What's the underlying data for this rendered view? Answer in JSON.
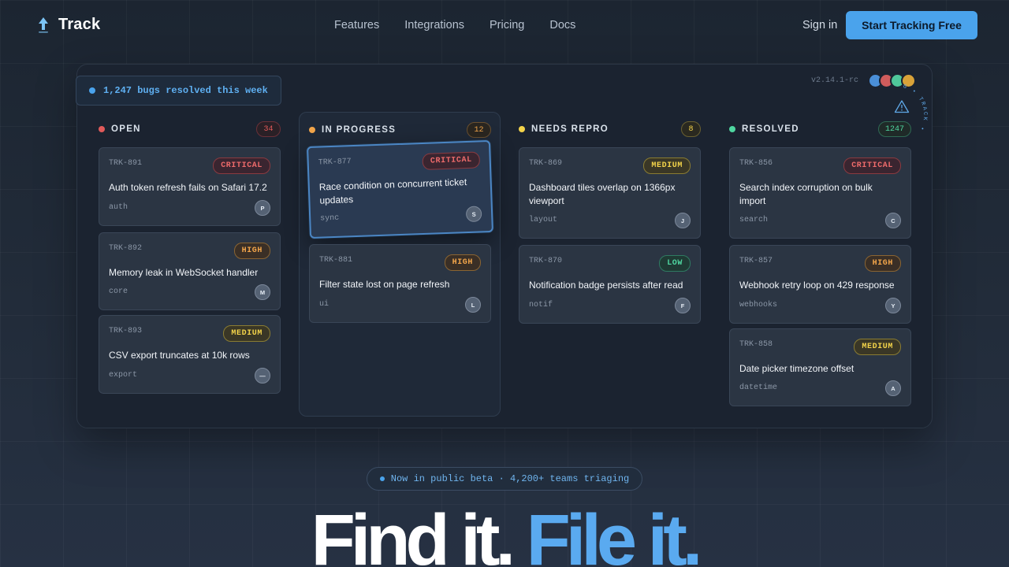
{
  "brand": {
    "name": "Track"
  },
  "nav": {
    "links": [
      "Features",
      "Integrations",
      "Pricing",
      "Docs"
    ],
    "signin": "Sign in",
    "cta": "Start Tracking Free"
  },
  "board": {
    "resolved_banner": "1,247 bugs resolved this week",
    "version": "v2.14.1-rc",
    "ring_text": "BUG • TRACK •",
    "columns": [
      {
        "title": "OPEN",
        "count": "34",
        "color": "#e05a5a",
        "cards": [
          {
            "id": "TRK-891",
            "severity": "CRITICAL",
            "title": "Auth token refresh fails on Safari 17.2",
            "tag": "auth",
            "assignee": "P"
          },
          {
            "id": "TRK-892",
            "severity": "HIGH",
            "title": "Memory leak in WebSocket handler",
            "tag": "core",
            "assignee": "M"
          },
          {
            "id": "TRK-893",
            "severity": "MEDIUM",
            "title": "CSV export truncates at 10k rows",
            "tag": "export",
            "assignee": "—"
          }
        ]
      },
      {
        "title": "IN PROGRESS",
        "count": "12",
        "color": "#f2a54a",
        "cards": [
          {
            "id": "TRK-877",
            "severity": "CRITICAL",
            "title": "Race condition on concurrent ticket updates",
            "tag": "sync",
            "assignee": "S"
          },
          {
            "id": "TRK-881",
            "severity": "HIGH",
            "title": "Filter state lost on page refresh",
            "tag": "ui",
            "assignee": "L"
          }
        ]
      },
      {
        "title": "NEEDS REPRO",
        "count": "8",
        "color": "#f3d34a",
        "cards": [
          {
            "id": "TRK-869",
            "severity": "MEDIUM",
            "title": "Dashboard tiles overlap on 1366px viewport",
            "tag": "layout",
            "assignee": "J"
          },
          {
            "id": "TRK-870",
            "severity": "LOW",
            "title": "Notification badge persists after read",
            "tag": "notif",
            "assignee": "F"
          }
        ]
      },
      {
        "title": "RESOLVED",
        "count": "1247",
        "color": "#4fd6a0",
        "cards": [
          {
            "id": "TRK-856",
            "severity": "CRITICAL",
            "title": "Search index corruption on bulk import",
            "tag": "search",
            "assignee": "C"
          },
          {
            "id": "TRK-857",
            "severity": "HIGH",
            "title": "Webhook retry loop on 429 response",
            "tag": "webhooks",
            "assignee": "Y"
          },
          {
            "id": "TRK-858",
            "severity": "MEDIUM",
            "title": "Date picker timezone offset",
            "tag": "datetime",
            "assignee": "A"
          }
        ]
      }
    ]
  },
  "hero": {
    "badge": "Now in public beta · 4,200+ teams triaging",
    "headline_part1": "Find it. ",
    "headline_part2": "File it."
  },
  "colors": {
    "accent": "#4aa3ec",
    "background": "#1c2531"
  },
  "icons": [
    "logo-icon",
    "warning-icon"
  ]
}
